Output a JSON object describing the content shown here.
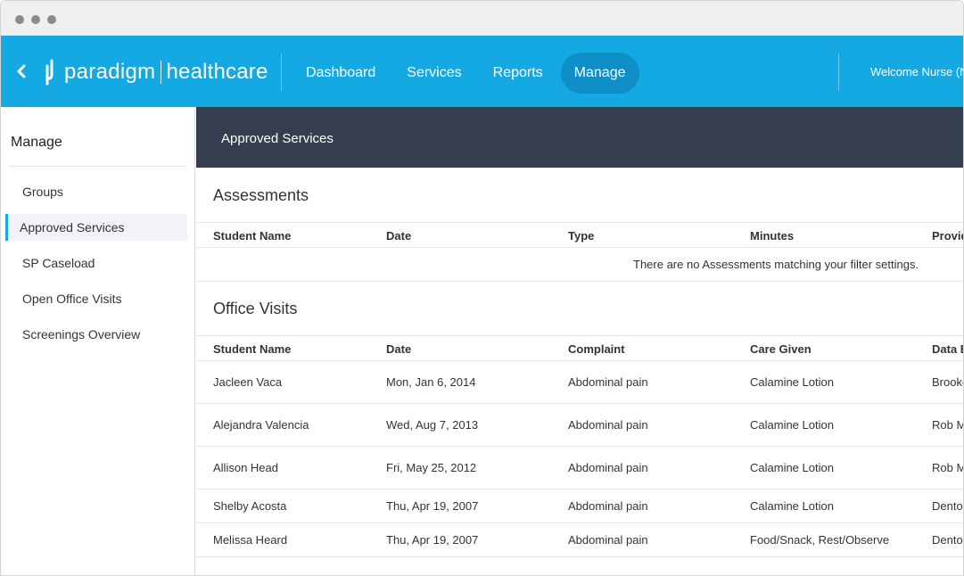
{
  "topbar": {
    "brand": "paradigm",
    "product": "healthcare",
    "nav": [
      "Dashboard",
      "Services",
      "Reports",
      "Manage"
    ],
    "active_nav": "Manage",
    "welcome": "Welcome Nurse (N"
  },
  "sidebar": {
    "title": "Manage",
    "items": [
      "Groups",
      "Approved Services",
      "SP Caseload",
      "Open Office Visits",
      "Screenings Overview"
    ],
    "active_item": "Approved Services"
  },
  "page": {
    "title": "Approved Services"
  },
  "assessments": {
    "title": "Assessments",
    "columns": [
      "Student Name",
      "Date",
      "Type",
      "Minutes",
      "Provid"
    ],
    "empty_message": "There are no Assessments matching your filter settings."
  },
  "office_visits": {
    "title": "Office Visits",
    "columns": [
      "Student Name",
      "Date",
      "Complaint",
      "Care Given",
      "Data E"
    ],
    "rows": [
      [
        "Jacleen Vaca",
        "Mon, Jan 6, 2014",
        "Abdominal pain",
        "Calamine Lotion",
        "Brooke"
      ],
      [
        "Alejandra Valencia",
        "Wed, Aug 7, 2013",
        "Abdominal pain",
        "Calamine Lotion",
        "Rob M"
      ],
      [
        "Allison Head",
        "Fri, May 25, 2012",
        "Abdominal pain",
        "Calamine Lotion",
        "Rob M"
      ],
      [
        "Shelby Acosta",
        "Thu, Apr 19, 2007",
        "Abdominal pain",
        "Calamine Lotion",
        "Denton"
      ],
      [
        "Melissa Heard",
        "Thu, Apr 19, 2007",
        "Abdominal pain",
        "Food/Snack, Rest/Observe",
        "Denton"
      ]
    ]
  },
  "colors": {
    "brand_blue": "#14a9e3",
    "active_nav": "#0f8fc7",
    "header_dark": "#353e4f"
  },
  "icons": {
    "back": "chevron-left-icon",
    "logo": "paradigm-logo-icon"
  }
}
